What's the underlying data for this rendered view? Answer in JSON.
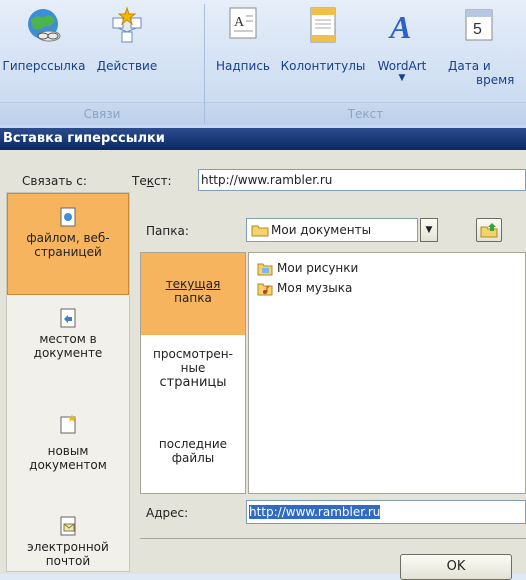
{
  "ribbon": {
    "buttons": [
      {
        "label": "Гиперссылка",
        "icon": "globe-link-icon"
      },
      {
        "label": "Действие",
        "icon": "action-star-icon"
      },
      {
        "label": "Надпись",
        "icon": "textbox-icon"
      },
      {
        "label": "Колонтитулы",
        "icon": "header-footer-icon"
      },
      {
        "label": "WordArt",
        "icon": "wordart-icon"
      },
      {
        "label": "Дата и",
        "label2": "время",
        "icon": "date-time-icon"
      }
    ],
    "groups": {
      "links": "Связи",
      "text": "Текст"
    }
  },
  "dialog": {
    "title": "Вставка гиперссылки",
    "link_to_label": "Связать с:",
    "text_label_pre": "Те",
    "text_label_u": "к",
    "text_label_post": "ст:",
    "text_value": "http://www.rambler.ru",
    "places": [
      {
        "line1": "файлом, веб-",
        "line2": "страницей",
        "icon": "file-web-icon"
      },
      {
        "line1": "местом в",
        "line2": "документе",
        "icon": "place-in-document-icon"
      },
      {
        "line1": "новым",
        "line2": "документом",
        "icon": "new-document-icon"
      },
      {
        "line1": "электронной",
        "line2": "почтой",
        "icon": "email-icon"
      }
    ],
    "folder_label": "Папка:",
    "folder_value": "Мои документы",
    "browse": [
      {
        "line1": "текущая",
        "line2": "папка"
      },
      {
        "line1": "просмотрен-",
        "line2": "ные",
        "line3": "страницы"
      },
      {
        "line1": "последние",
        "line2": "файлы"
      }
    ],
    "files": [
      {
        "name": "Мои рисунки",
        "icon": "pictures-folder-icon"
      },
      {
        "name": "Моя музыка",
        "icon": "music-folder-icon"
      }
    ],
    "address_label": "Адрес:",
    "address_value": "http://www.rambler.ru",
    "ok_label": "OK"
  }
}
